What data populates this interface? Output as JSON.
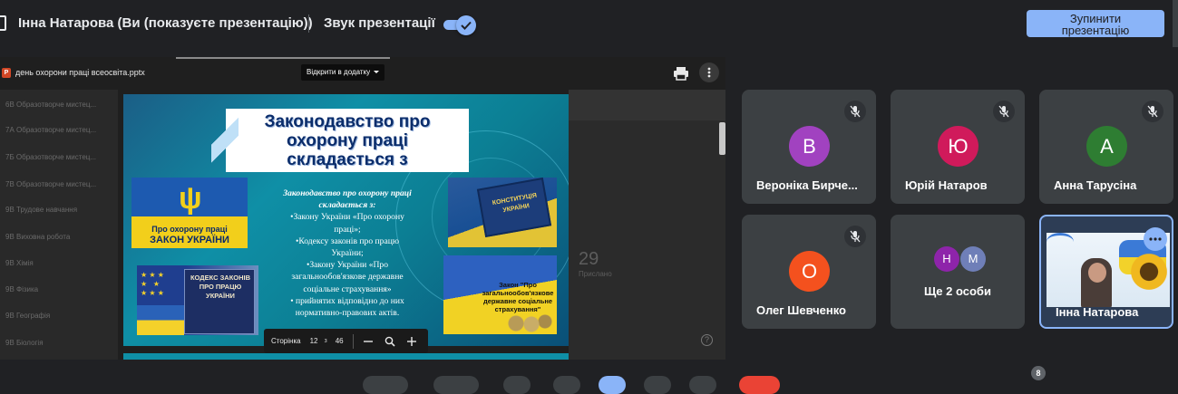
{
  "topbar": {
    "presenter_name": "Інна Натарова (Ви (показуєте презентацію))",
    "sound_label": "Звук презентації",
    "sound_toggle_on": true,
    "stop_button_line1": "Зупинити",
    "stop_button_line2": "презентацію"
  },
  "presentation": {
    "file_name": "день охорони праці всеосвіта.pptx",
    "open_with_label": "Відкрити в додатку",
    "background_items": [
      "6В Образотворче мистец...",
      "7А Образотворче мистец...",
      "7Б Образотворче мистец...",
      "7В Образотворче мистец...",
      "9В Трудове навчання",
      "9В Виховна робота",
      "9В Хімія",
      "9В Фізика",
      "9В Географія",
      "9В Біологія"
    ],
    "background_number": "29",
    "background_number_label": "Прислано",
    "slide": {
      "title_line1": "Законодавство про",
      "title_line2": "охорону праці",
      "title_line3": "складається з",
      "body_heading_line1": "Законодавство про охорону праці",
      "body_heading_line2": "складається з:",
      "body_lines": [
        "•Закону України «Про охорону",
        "праці»;",
        "•Кодексу законів про працю",
        "України;",
        "•Закону України «Про",
        "загальнообов'язкове державне",
        "соціальне страхування»",
        "• прийнятих відповідно до них",
        "нормативно-правових актів."
      ],
      "image_law_line1": "Про охорону праці",
      "image_law_line2": "ЗАКОН УКРАЇНИ",
      "image_constitution_line1": "КОНСТИТУЦІЯ",
      "image_constitution_line2": "УКРАЇНИ",
      "image_codex_line1": "КОДЕКС ЗАКОНІВ",
      "image_codex_line2": "ПРО ПРАЦЮ",
      "image_codex_line3": "УКРАЇНИ",
      "image_insurance_text": "Закон \"Про загальнообов'язкове державне соціальне страхування\""
    },
    "page_control": {
      "label": "Сторінка",
      "current": "12",
      "separator": "з",
      "total": "46"
    }
  },
  "participants": [
    {
      "initial": "В",
      "name": "Вероніка Бирче...",
      "color": "#a142c0",
      "muted": true
    },
    {
      "initial": "Ю",
      "name": "Юрій Натаров",
      "color": "#d01a5b",
      "muted": true
    },
    {
      "initial": "А",
      "name": "Анна Тарусіна",
      "color": "#2e7d32",
      "muted": true
    },
    {
      "initial": "О",
      "name": "Олег Шевченко",
      "color": "#f4511e",
      "muted": true
    }
  ],
  "more_people": {
    "label": "Ще 2 особи",
    "avatars": [
      {
        "initial": "Н",
        "color": "#8e24aa"
      },
      {
        "initial": "М",
        "color": "#6f7fb8"
      }
    ]
  },
  "self_tile": {
    "name": "Інна Натарова"
  },
  "participants_badge": "8",
  "colors": {
    "accent": "#8ab4f8",
    "background": "#202124",
    "tile": "#3c4043"
  }
}
